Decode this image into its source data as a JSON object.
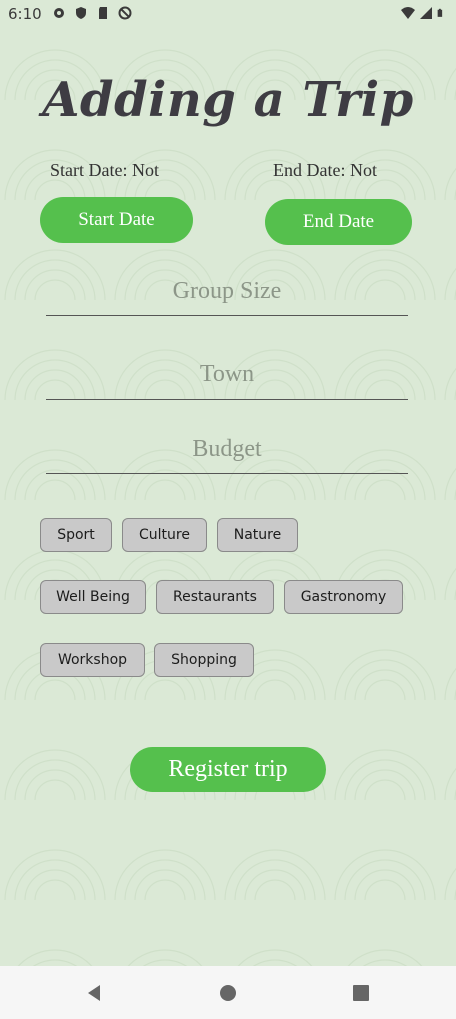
{
  "status_bar": {
    "time": "6:10",
    "left_icons": [
      "settings-icon",
      "shield-icon",
      "sd-card-icon",
      "do-not-disturb-icon"
    ],
    "right_icons": [
      "wifi-icon",
      "signal-icon",
      "battery-icon"
    ]
  },
  "page": {
    "title": "Adding a Trip"
  },
  "dates": {
    "start_label": "Start Date: Not",
    "end_label": "End Date: Not",
    "start_button": "Start Date",
    "end_button": "End Date"
  },
  "fields": {
    "group_size_placeholder": "Group Size",
    "town_placeholder": "Town",
    "budget_placeholder": "Budget"
  },
  "categories": [
    "Sport",
    "Culture",
    "Nature",
    "Well Being",
    "Restaurants",
    "Gastronomy",
    "Workshop",
    "Shopping"
  ],
  "actions": {
    "register_label": "Register trip"
  },
  "colors": {
    "background": "#dbe9d6",
    "accent": "#55c04d",
    "chip": "#c9c9c9",
    "title": "#3e3c43"
  },
  "nav_bar": {
    "icons": [
      "back-icon",
      "home-icon",
      "recents-icon"
    ]
  }
}
